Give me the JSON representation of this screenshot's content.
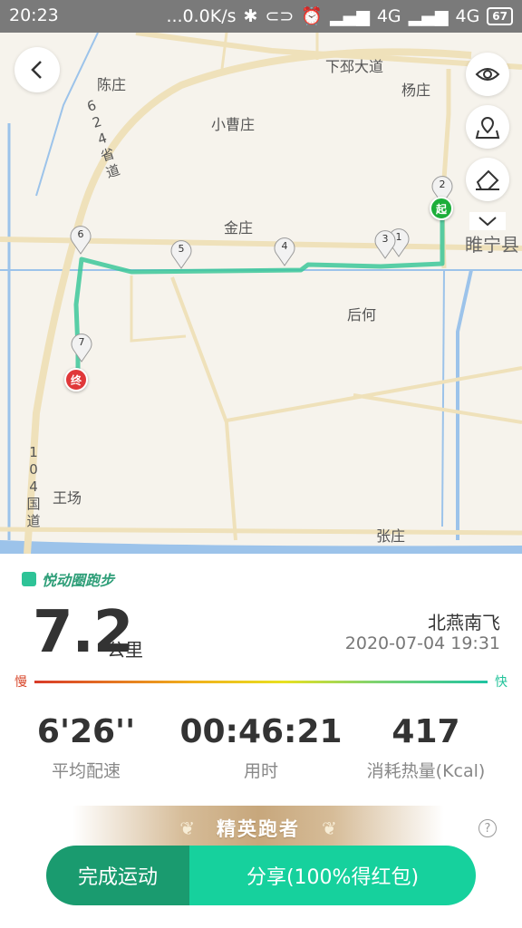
{
  "status_bar": {
    "time": "20:23",
    "net_speed": "...0.0K/s",
    "network1": "4G",
    "network2": "4G",
    "battery": "67"
  },
  "map": {
    "labels": [
      "陈庄",
      "下邳大道",
      "杨庄",
      "小曹庄",
      "金庄",
      "睢宁县",
      "后何",
      "王场",
      "张庄"
    ],
    "road_624": [
      "6",
      "2",
      "4",
      "省",
      "道"
    ],
    "road_104": [
      "1",
      "0",
      "4",
      "国",
      "道"
    ],
    "pins": [
      "1",
      "2",
      "3",
      "4",
      "5",
      "6",
      "7"
    ],
    "start_label": "起",
    "end_label": "终",
    "route_color": "#3cc79a"
  },
  "panel": {
    "brand": "悦动圈跑步",
    "distance": "7.2",
    "distance_unit": "公里",
    "user": "北燕南飞",
    "datetime": "2020-07-04 19:31",
    "slow_label": "慢",
    "fast_label": "快",
    "stats": [
      {
        "value": "6'26''",
        "label": "平均配速"
      },
      {
        "value": "00:46:21",
        "label": "用时"
      },
      {
        "value": "417",
        "label": "消耗热量(Kcal)"
      }
    ],
    "elite_badge": "精英跑者",
    "finish_button": "完成运动",
    "share_button": "分享(100%得红包)"
  }
}
